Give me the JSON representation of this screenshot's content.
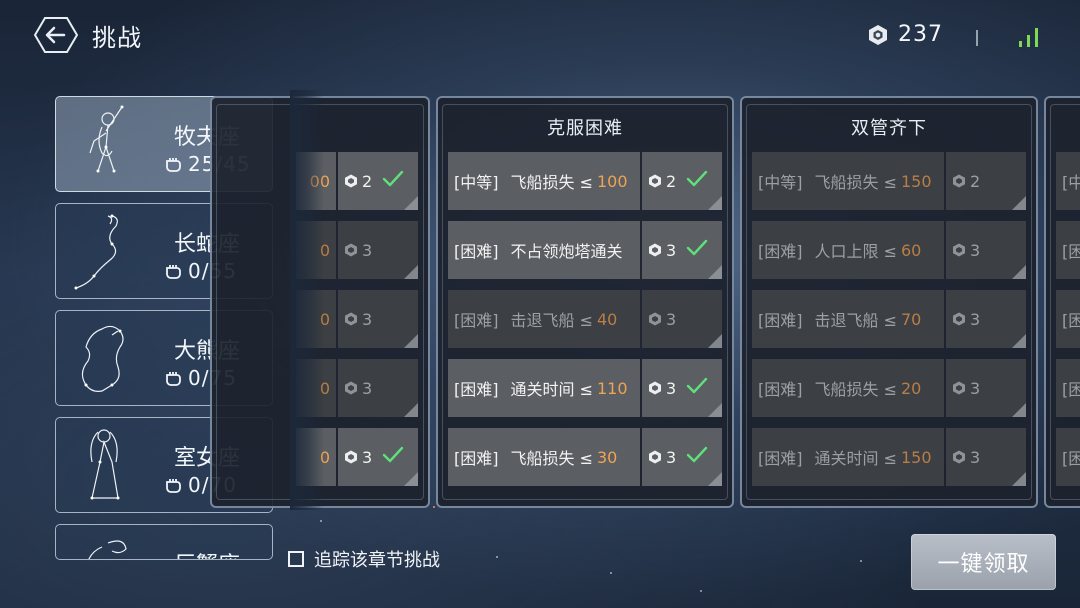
{
  "header": {
    "title": "挑战",
    "currency_value": "237"
  },
  "sidebar": {
    "items": [
      {
        "name": "牧夫座",
        "progress": "25/45",
        "active": true
      },
      {
        "name": "长蛇座",
        "progress": "0/55",
        "active": false
      },
      {
        "name": "大熊座",
        "progress": "0/75",
        "active": false
      },
      {
        "name": "室女座",
        "progress": "0/70",
        "active": false
      },
      {
        "name": "巨蟹座",
        "progress": "",
        "active": false
      }
    ]
  },
  "left_partial_column": {
    "rows": [
      {
        "num_fragment": "00",
        "reward": "2",
        "done": true
      },
      {
        "num_fragment": "0",
        "reward": "3",
        "done": false
      },
      {
        "num_fragment": "0",
        "reward": "3",
        "done": false
      },
      {
        "num_fragment": "0",
        "reward": "3",
        "done": false
      },
      {
        "num_fragment": "0",
        "reward": "3",
        "done": true
      }
    ]
  },
  "columns": [
    {
      "title": "克服困难",
      "rows": [
        {
          "level": "[中等]",
          "text": "飞船损失 ≤",
          "num": "100",
          "reward": "2",
          "done": true,
          "dim": false
        },
        {
          "level": "[困难]",
          "text": "不占领炮塔通关",
          "num": "",
          "reward": "3",
          "done": true,
          "dim": false
        },
        {
          "level": "[困难]",
          "text": "击退飞船 ≤",
          "num": "40",
          "reward": "3",
          "done": false,
          "dim": true
        },
        {
          "level": "[困难]",
          "text": "通关时间 ≤",
          "num": "110",
          "reward": "3",
          "done": true,
          "dim": false
        },
        {
          "level": "[困难]",
          "text": "飞船损失 ≤",
          "num": "30",
          "reward": "3",
          "done": true,
          "dim": false
        }
      ]
    },
    {
      "title": "双管齐下",
      "rows": [
        {
          "level": "[中等]",
          "text": "飞船损失 ≤",
          "num": "150",
          "reward": "2",
          "done": false,
          "dim": true
        },
        {
          "level": "[困难]",
          "text": "人口上限 ≤",
          "num": "60",
          "reward": "3",
          "done": false,
          "dim": true
        },
        {
          "level": "[困难]",
          "text": "击退飞船 ≤",
          "num": "70",
          "reward": "3",
          "done": false,
          "dim": true
        },
        {
          "level": "[困难]",
          "text": "飞船损失 ≤",
          "num": "20",
          "reward": "3",
          "done": false,
          "dim": true
        },
        {
          "level": "[困难]",
          "text": "通关时间 ≤",
          "num": "150",
          "reward": "3",
          "done": false,
          "dim": true
        }
      ]
    }
  ],
  "right_partial_column": {
    "rows": [
      {
        "fragment": "[中"
      },
      {
        "fragment": "[困"
      },
      {
        "fragment": "[困"
      },
      {
        "fragment": "[困"
      },
      {
        "fragment": "[困"
      }
    ]
  },
  "footer": {
    "track_label": "追踪该章节挑战",
    "claim_all_label": "一键领取"
  },
  "colors": {
    "accent_number": "#f0a352",
    "check_green": "#5fe07a",
    "signal_green": "#7ed957"
  },
  "icons": {
    "back": "arrow-left-icon",
    "currency": "hexagon-gem-icon",
    "signal": "signal-bars-icon",
    "progress": "fist-icon",
    "reward": "gem-icon",
    "done": "checkmark-icon"
  }
}
